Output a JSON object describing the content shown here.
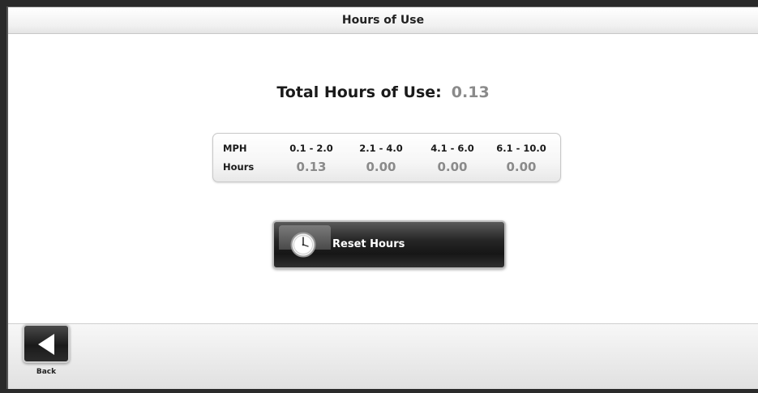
{
  "header": {
    "title": "Hours of Use"
  },
  "total": {
    "label": "Total Hours of Use:",
    "value": "0.13"
  },
  "speed_table": {
    "header_label": "MPH",
    "row_label": "Hours",
    "ranges": [
      "0.1 - 2.0",
      "2.1 - 4.0",
      "4.1 - 6.0",
      "6.1 - 10.0"
    ],
    "hours": [
      "0.13",
      "0.00",
      "0.00",
      "0.00"
    ]
  },
  "reset_button": {
    "label": "Reset Hours",
    "icon": "clock-icon"
  },
  "footer": {
    "back_label": "Back",
    "back_icon": "back-arrow-icon"
  },
  "colors": {
    "value_gray": "#8a8a8a",
    "button_dark": "#1a1a1a",
    "background": "#ffffff"
  }
}
